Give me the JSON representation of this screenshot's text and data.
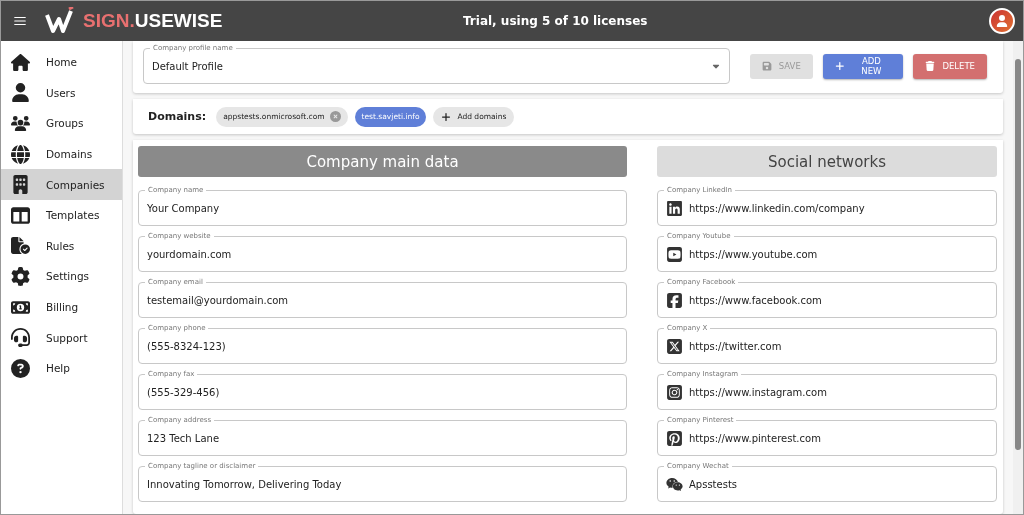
{
  "header": {
    "brand_prefix": "SIGN.",
    "brand_suffix": "USEWISE",
    "license_note": "Trial, using 5 of 10 licenses"
  },
  "sidebar": {
    "items": [
      {
        "label": "Home",
        "selected": false
      },
      {
        "label": "Users",
        "selected": false
      },
      {
        "label": "Groups",
        "selected": false
      },
      {
        "label": "Domains",
        "selected": false
      },
      {
        "label": "Companies",
        "selected": true
      },
      {
        "label": "Templates",
        "selected": false
      },
      {
        "label": "Rules",
        "selected": false
      },
      {
        "label": "Settings",
        "selected": false
      },
      {
        "label": "Billing",
        "selected": false
      },
      {
        "label": "Support",
        "selected": false
      },
      {
        "label": "Help",
        "selected": false
      }
    ]
  },
  "profile": {
    "label": "Company profile name",
    "value": "Default Profile"
  },
  "buttons": [
    {
      "kind": "save",
      "label": "SAVE",
      "disabled": true
    },
    {
      "kind": "add",
      "label": "ADD NEW",
      "disabled": false
    },
    {
      "kind": "delete",
      "label": "DELETE",
      "disabled": false
    }
  ],
  "domains": {
    "label": "Domains:",
    "chips": [
      {
        "label": "appstests.onmicrosoft.com",
        "selected": false
      },
      {
        "label": "test.savjeti.info",
        "selected": true
      }
    ],
    "add_label": "Add domains"
  },
  "main_data": {
    "title": "Company main data",
    "fields": [
      {
        "label": "Company name",
        "value": "Your Company"
      },
      {
        "label": "Company website",
        "value": "yourdomain.com"
      },
      {
        "label": "Company email",
        "value": "testemail@yourdomain.com"
      },
      {
        "label": "Company phone",
        "value": "(555-8324-123)"
      },
      {
        "label": "Company fax",
        "value": "(555-329-456)"
      },
      {
        "label": "Company address",
        "value": "123 Tech Lane"
      },
      {
        "label": "Company tagline or disclaimer",
        "value": "Innovating Tomorrow, Delivering Today"
      }
    ]
  },
  "social": {
    "title": "Social networks",
    "fields": [
      {
        "kind": "linkedin",
        "label": "Company LinkedIn",
        "value": "https://www.linkedin.com/company"
      },
      {
        "kind": "youtube",
        "label": "Company Youtube",
        "value": "https://www.youtube.com"
      },
      {
        "kind": "facebook",
        "label": "Company Facebook",
        "value": "https://www.facebook.com"
      },
      {
        "kind": "x",
        "label": "Company X",
        "value": "https://twitter.com"
      },
      {
        "kind": "instagram",
        "label": "Company Instagram",
        "value": "https://www.instagram.com"
      },
      {
        "kind": "pinterest",
        "label": "Company Pinterest",
        "value": "https://www.pinterest.com"
      },
      {
        "kind": "wechat",
        "label": "Company Wechat",
        "value": "Apsstests"
      }
    ]
  }
}
